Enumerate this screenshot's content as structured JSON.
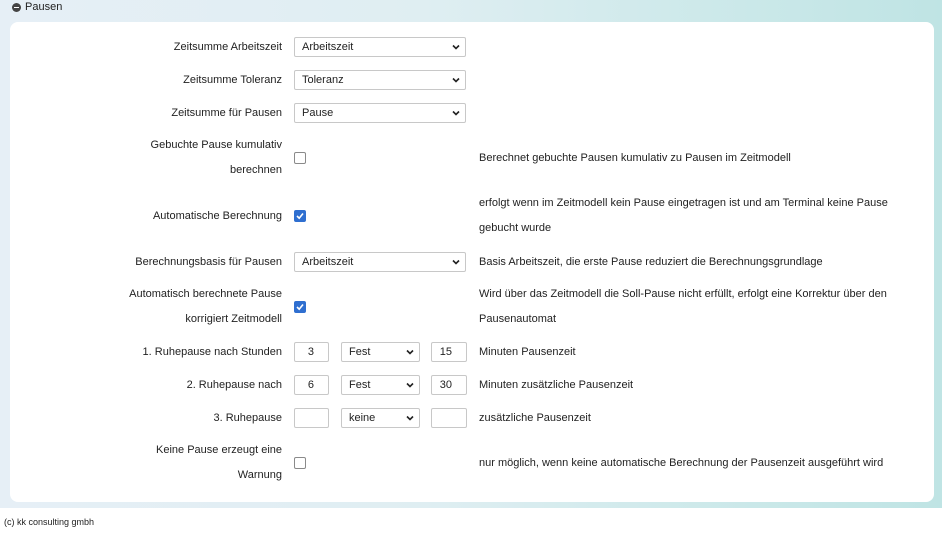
{
  "section": {
    "title": "Pausen"
  },
  "fields": {
    "arbeitszeit": {
      "label": "Zeitsumme Arbeitszeit",
      "value": "Arbeitszeit"
    },
    "toleranz": {
      "label": "Zeitsumme Toleranz",
      "value": "Toleranz"
    },
    "pausen": {
      "label": "Zeitsumme für Pausen",
      "value": "Pause"
    },
    "kumulativ": {
      "label_line1": "Gebuchte Pause kumulativ",
      "label_line2": "berechnen",
      "checked": false,
      "description": "Berechnet gebuchte Pausen kumulativ zu Pausen im Zeitmodell"
    },
    "automatisch": {
      "label": "Automatische Berechnung",
      "checked": true,
      "description_line1": "erfolgt wenn im Zeitmodell kein Pause eingetragen ist und am Terminal keine Pause",
      "description_line2": "gebucht wurde"
    },
    "basis": {
      "label": "Berechnungsbasis für Pausen",
      "value": "Arbeitszeit",
      "description": "Basis Arbeitszeit, die erste Pause reduziert die Berechnungsgrundlage"
    },
    "korrektur": {
      "label_line1": "Automatisch berechnete Pause",
      "label_line2": "korrigiert Zeitmodell",
      "checked": true,
      "description_line1": "Wird über das Zeitmodell die Soll-Pause nicht erfüllt, erfolgt eine Korrektur über den",
      "description_line2": "Pausenautomat"
    },
    "ruhe1": {
      "label": "1. Ruhepause nach Stunden",
      "hours": "3",
      "mode": "Fest",
      "minutes": "15",
      "description": "Minuten Pausenzeit"
    },
    "ruhe2": {
      "label": "2. Ruhepause nach",
      "hours": "6",
      "mode": "Fest",
      "minutes": "30",
      "description": "Minuten zusätzliche Pausenzeit"
    },
    "ruhe3": {
      "label": "3. Ruhepause",
      "hours": "",
      "mode": "keine",
      "minutes": "",
      "description": "zusätzliche Pausenzeit"
    },
    "warnung": {
      "label_line1": "Keine Pause erzeugt eine",
      "label_line2": "Warnung",
      "checked": false,
      "description": "nur möglich, wenn keine automatische Berechnung der Pausenzeit ausgeführt wird"
    }
  },
  "footer": {
    "text": "(c) kk consulting gmbh"
  },
  "colors": {
    "checkbox_checked": "#2f6fd0",
    "panel": "#ffffff"
  }
}
